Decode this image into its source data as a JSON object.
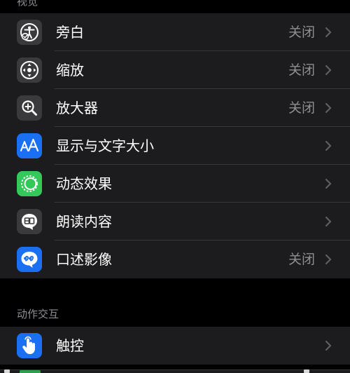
{
  "sections": {
    "vision_header": "视觉",
    "interaction_header": "动作交互"
  },
  "vision_rows": [
    {
      "label": "旁白",
      "value": "关闭",
      "icon": "voiceover-icon",
      "icon_bg": "#3a3a3c"
    },
    {
      "label": "缩放",
      "value": "关闭",
      "icon": "zoom-icon",
      "icon_bg": "#3a3a3c"
    },
    {
      "label": "放大器",
      "value": "关闭",
      "icon": "magnifier-icon",
      "icon_bg": "#3a3a3c"
    },
    {
      "label": "显示与文字大小",
      "value": "",
      "icon": "text-size-icon",
      "icon_bg": "#1a6ff2"
    },
    {
      "label": "动态效果",
      "value": "",
      "icon": "motion-icon",
      "icon_bg": "#34c759"
    },
    {
      "label": "朗读内容",
      "value": "",
      "icon": "spoken-content-icon",
      "icon_bg": "#3a3a3c"
    },
    {
      "label": "口述影像",
      "value": "关闭",
      "icon": "audio-descriptions-icon",
      "icon_bg": "#1a6ff2"
    }
  ],
  "interaction_rows": [
    {
      "label": "触控",
      "value": "",
      "icon": "touch-icon",
      "icon_bg": "#1a6ff2"
    }
  ],
  "colors": {
    "background": "#000000",
    "group_background": "#1c1c1e",
    "separator": "#38383a",
    "secondary_text": "#8e8e93",
    "accent_blue": "#1a6ff2",
    "accent_green": "#34c759"
  }
}
